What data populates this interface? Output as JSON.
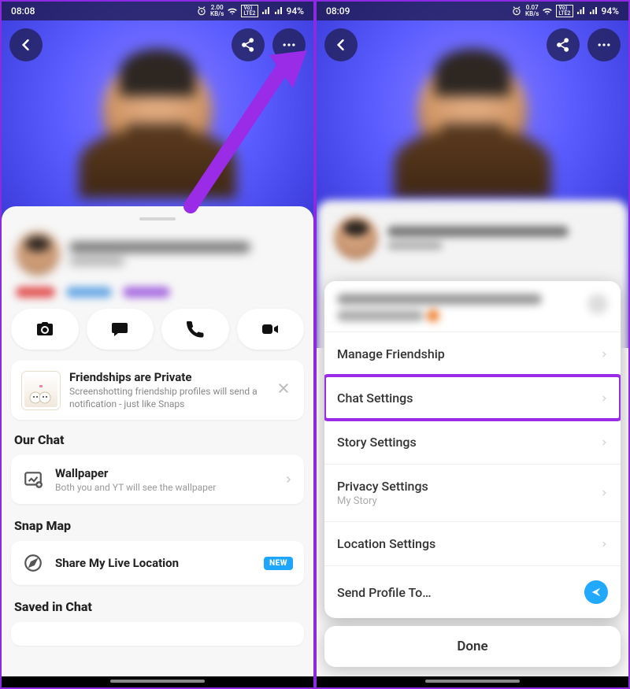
{
  "left": {
    "status": {
      "time": "08:08",
      "speed_top": "2.00",
      "speed_bot": "KB/s",
      "battery": "94%"
    },
    "privacy_card": {
      "title": "Friendships are Private",
      "sub": "Screenshotting friendship profiles will send a notification - just like Snaps"
    },
    "sections": {
      "our_chat": "Our Chat",
      "wallpaper_title": "Wallpaper",
      "wallpaper_sub": "Both you and YT will see the wallpaper",
      "snap_map": "Snap Map",
      "share_loc": "Share My Live Location",
      "new_badge": "NEW",
      "saved": "Saved in Chat"
    }
  },
  "right": {
    "status": {
      "time": "08:09",
      "speed_top": "0.07",
      "speed_bot": "KB/s",
      "battery": "94%"
    },
    "menu": {
      "manage": "Manage Friendship",
      "chat": "Chat Settings",
      "story": "Story Settings",
      "privacy": "Privacy Settings",
      "privacy_sub": "My Story",
      "location": "Location Settings",
      "send": "Send Profile To…"
    },
    "done": "Done"
  }
}
